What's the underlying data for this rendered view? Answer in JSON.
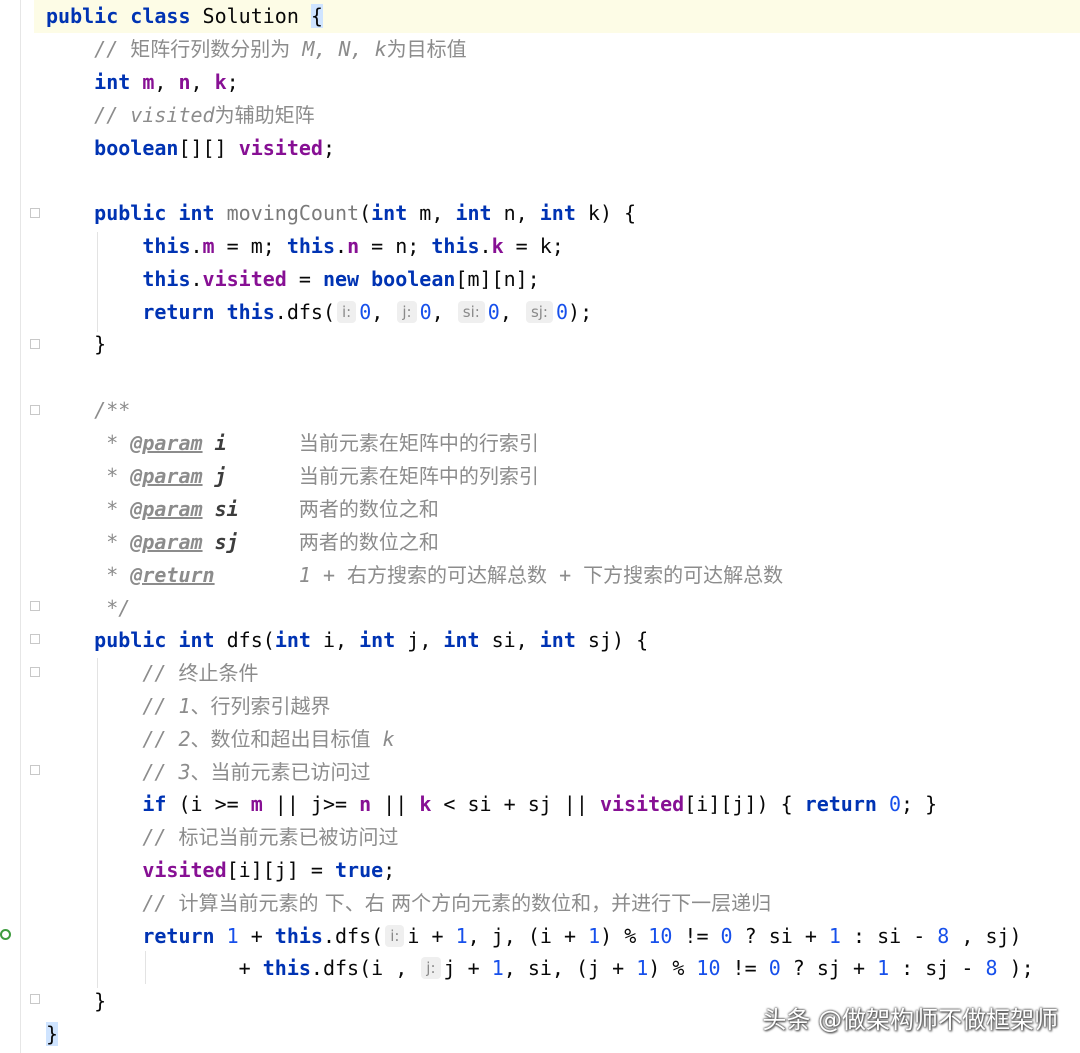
{
  "lines": [
    "<span class=\"kw\">public class</span> Solution <span class=\"bracehl\">{</span>",
    "    <span class=\"cm\">// </span><span class=\"cmzh\">矩阵行列数分别为</span><span class=\"cm\"> M, N, k</span><span class=\"cmzh\">为目标值</span>",
    "    <span class=\"kw\">int</span> <span class=\"fld\">m</span>, <span class=\"fld\">n</span>, <span class=\"fld\">k</span>;",
    "    <span class=\"cm\">// visited</span><span class=\"cmzh\">为辅助矩阵</span>",
    "    <span class=\"kw\">boolean</span>[][] <span class=\"fld\">visited</span>;",
    "",
    "    <span class=\"kw\">public int</span> <span class=\"fn\">movingCount</span>(<span class=\"kw\">int</span> m, <span class=\"kw\">int</span> n, <span class=\"kw\">int</span> k) {",
    "        <span class=\"kw\">this</span>.<span class=\"fld\">m</span> = m; <span class=\"kw\">this</span>.<span class=\"fld\">n</span> = n; <span class=\"kw\">this</span>.<span class=\"fld\">k</span> = k;",
    "        <span class=\"kw\">this</span>.<span class=\"fld\">visited</span> = <span class=\"kw\">new boolean</span>[m][n];",
    "        <span class=\"kw\">return this</span>.dfs(<span class=\"hint\">i:</span><span class=\"num\">0</span>, <span class=\"hint\">j:</span><span class=\"num\">0</span>, <span class=\"hint\">si:</span><span class=\"num\">0</span>, <span class=\"hint\">sj:</span><span class=\"num\">0</span>);",
    "    }",
    "",
    "    <span class=\"cm\">/**</span>",
    "<span class=\"cm\">     * </span><span class=\"tag\">@param</span> <span class=\"pname\">i</span><span class=\"cm\">      </span><span class=\"cmzh\">当前元素在矩阵中的行索引</span>",
    "<span class=\"cm\">     * </span><span class=\"tag\">@param</span> <span class=\"pname\">j</span><span class=\"cm\">      </span><span class=\"cmzh\">当前元素在矩阵中的列索引</span>",
    "<span class=\"cm\">     * </span><span class=\"tag\">@param</span> <span class=\"pname\">si</span><span class=\"cm\">     </span><span class=\"cmzh\">两者的数位之和</span>",
    "<span class=\"cm\">     * </span><span class=\"tag\">@param</span> <span class=\"pname\">sj</span><span class=\"cm\">     </span><span class=\"cmzh\">两者的数位之和</span>",
    "<span class=\"cm\">     * </span><span class=\"tag\">@return</span><span class=\"cm\">       1 + </span><span class=\"cmzh\">右方搜索的可达解总数</span><span class=\"cm\"> + </span><span class=\"cmzh\">下方搜索的可达解总数</span>",
    "<span class=\"cm\">     */</span>",
    "    <span class=\"kw\">public int</span> dfs(<span class=\"kw\">int</span> i, <span class=\"kw\">int</span> j, <span class=\"kw\">int</span> si, <span class=\"kw\">int</span> sj) {",
    "        <span class=\"cm\">// </span><span class=\"cmzh\">终止条件</span>",
    "        <span class=\"cm\">// 1</span><span class=\"cmzh\">、行列索引越界</span>",
    "        <span class=\"cm\">// 2</span><span class=\"cmzh\">、数位和超出目标值</span><span class=\"cm\"> k</span>",
    "        <span class=\"cm\">// 3</span><span class=\"cmzh\">、当前元素已访问过</span>",
    "        <span class=\"kw\">if</span> (i >= <span class=\"fld\">m</span> || j>= <span class=\"fld\">n</span> || <span class=\"fld\">k</span> < si + sj || <span class=\"fld\">visited</span>[i][j]) { <span class=\"kw\">return</span> <span class=\"num\">0</span>; }",
    "        <span class=\"cm\">// </span><span class=\"cmzh\">标记当前元素已被访问过</span>",
    "        <span class=\"fld\">visited</span>[i][j] = <span class=\"kw\">true</span>;",
    "        <span class=\"cm\">// </span><span class=\"cmzh\">计算当前元素的 下、右 两个方向元素的数位和，并进行下一层递归</span>",
    "        <span class=\"kw\">return</span> <span class=\"num\">1</span> + <span class=\"kw\">this</span>.dfs(<span class=\"hint\">i:</span>i + <span class=\"num\">1</span>, j, (i + <span class=\"num\">1</span>) % <span class=\"num\">10</span> != <span class=\"num\">0</span> ? si + <span class=\"num\">1</span> : si - <span class=\"num\">8</span> , sj)",
    "                + <span class=\"kw\">this</span>.dfs(i , <span class=\"hint\">j:</span>j + <span class=\"num\">1</span>, si, (j + <span class=\"num\">1</span>) % <span class=\"num\">10</span> != <span class=\"num\">0</span> ? sj + <span class=\"num\">1</span> : sj - <span class=\"num\">8</span> );",
    "    }",
    "<span class=\"bracehl\">}</span>"
  ],
  "watermark": "头条 @做架构师不做框架师"
}
